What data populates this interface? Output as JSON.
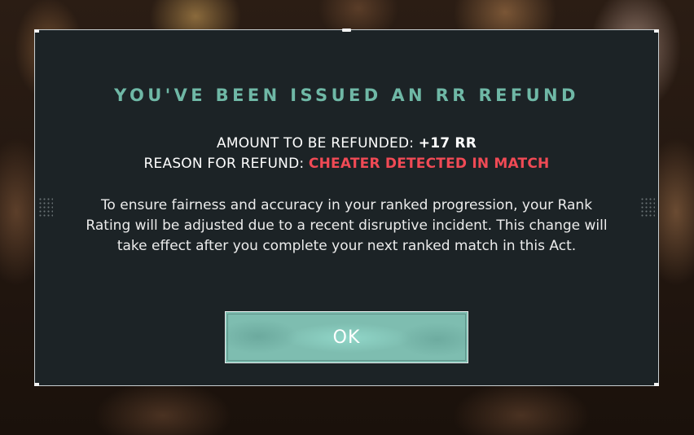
{
  "modal": {
    "title": "YOU'VE BEEN ISSUED AN RR REFUND",
    "amount_label": "AMOUNT TO BE REFUNDED:",
    "amount_value": "+17 RR",
    "reason_label": "REASON FOR REFUND:",
    "reason_value": "CHEATER DETECTED IN MATCH",
    "body": "To ensure fairness and accuracy in your ranked progression, your Rank Rating will be adjusted due to a recent disruptive incident. This change will take effect after you complete your next ranked match in this Act.",
    "ok_label": "OK"
  },
  "colors": {
    "title": "#6fb8a6",
    "reason_value": "#f04a55",
    "panel_bg": "#1c2326",
    "button_bg": "#7ebdb0"
  },
  "icons": {
    "left_grip": "drag-dots-icon",
    "right_grip": "drag-dots-icon"
  }
}
